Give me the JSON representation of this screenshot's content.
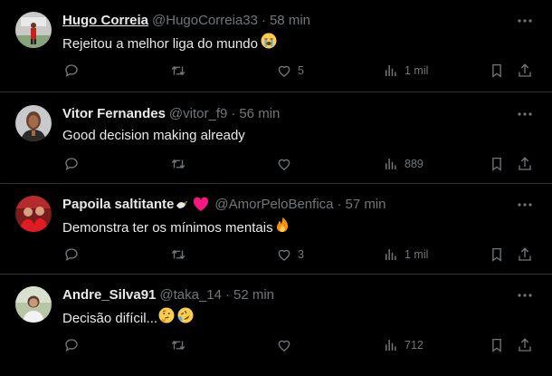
{
  "tweets": [
    {
      "name": "Hugo Correia",
      "handle": "@HugoCorreia33",
      "separator": "·",
      "time": "58 min",
      "text": "Rejeitou a melhor liga do mundo",
      "emoji": [
        "loudly-crying-face"
      ],
      "likes": "5",
      "views": "1 mil"
    },
    {
      "name": "Vitor Fernandes",
      "handle": "@vitor_f9",
      "separator": "·",
      "time": "56 min",
      "text": "Good decision making already",
      "emoji": [],
      "likes": "",
      "views": "889"
    },
    {
      "name": "Papoila saltitante",
      "handle": "@AmorPeloBenfica",
      "separator": "·",
      "time": "57 min",
      "text": "Demonstra ter os mínimos mentais",
      "emoji": [
        "fire"
      ],
      "name_badges": [
        "eagle",
        "red-heart"
      ],
      "likes": "3",
      "views": "1 mil"
    },
    {
      "name": "Andre_Silva91",
      "handle": "@taka_14",
      "separator": "·",
      "time": "52 min",
      "text": "Decisão difícil...",
      "emoji": [
        "thinking-face",
        "rolling-on-floor-laughing"
      ],
      "likes": "",
      "views": "712"
    }
  ],
  "colors": {
    "background": "#000000",
    "text": "#e7e9ea",
    "secondary": "#71767b",
    "divider": "#2f3336",
    "heart_badge": "#f91880"
  }
}
